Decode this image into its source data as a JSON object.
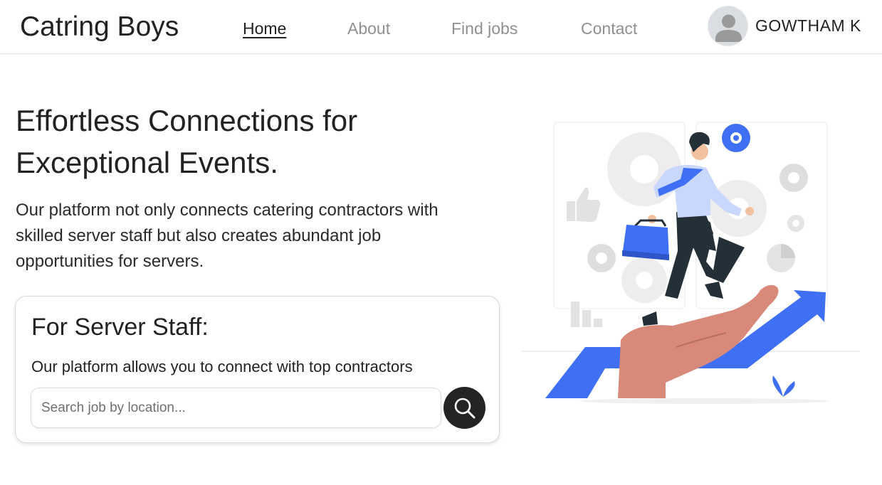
{
  "nav": {
    "brand": "Catring Boys",
    "links": [
      {
        "label": "Home",
        "active": true
      },
      {
        "label": "About",
        "active": false
      },
      {
        "label": "Find jobs",
        "active": false
      },
      {
        "label": "Contact",
        "active": false
      }
    ],
    "user": {
      "name": "GOWTHAM K",
      "avatar_icon": "user-avatar-icon"
    }
  },
  "hero": {
    "title_line1": "Effortless Connections for",
    "title_line2": "Exceptional Events.",
    "desc_line1": "Our platform not only connects catering contractors with",
    "desc_line2": "skilled server staff but also creates abundant job",
    "desc_line3": "opportunities for servers.",
    "illustration_icon": "career-growth-illustration"
  },
  "staff_card": {
    "title": "For Server Staff:",
    "text": "Our platform allows you to connect with top contractors",
    "search": {
      "placeholder": "Search job by location...",
      "value": "",
      "button_icon": "search-icon"
    }
  },
  "colors": {
    "accent_blue": "#3f6ff5",
    "dark": "#242424",
    "muted_text": "#8f8f8f",
    "hand": "#d8897a"
  }
}
